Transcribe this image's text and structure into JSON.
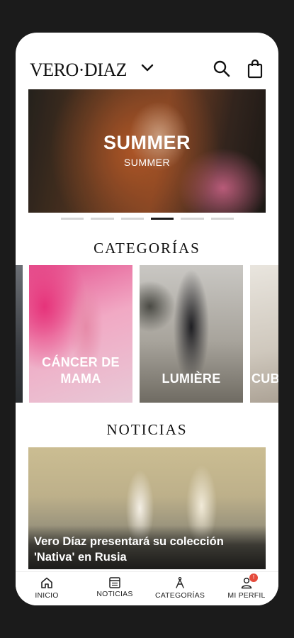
{
  "header": {
    "logo": "VERO·DIAZ",
    "icons": [
      "chevron-down-icon",
      "search-icon",
      "shopping-bag-icon"
    ]
  },
  "banner": {
    "title": "SUMMER",
    "subtitle": "SUMMER",
    "slide_count": 6,
    "active_slide": 4
  },
  "categories": {
    "title": "CATEGORÍAS",
    "items": [
      {
        "label": ""
      },
      {
        "label": "CÁNCER DE MAMA"
      },
      {
        "label": "LUMIÈRE"
      },
      {
        "label": "CUB"
      }
    ]
  },
  "news": {
    "title": "NOTICIAS",
    "items": [
      {
        "caption": "Vero Díaz presentará su colección 'Nativa' en Rusia"
      }
    ]
  },
  "bottom_nav": {
    "items": [
      {
        "label": "INICIO",
        "icon": "home-icon"
      },
      {
        "label": "NOTICIAS",
        "icon": "newspaper-icon"
      },
      {
        "label": "CATEGORÍAS",
        "icon": "hanger-icon"
      },
      {
        "label": "MI PERFIL",
        "icon": "user-icon",
        "badge": "!"
      }
    ]
  },
  "colors": {
    "background": "#1b1b1b",
    "surface": "#ffffff",
    "text": "#111111",
    "badge": "#e54b3c",
    "indicator_active": "#1a1a1a",
    "indicator_inactive": "#d6d6d6"
  }
}
